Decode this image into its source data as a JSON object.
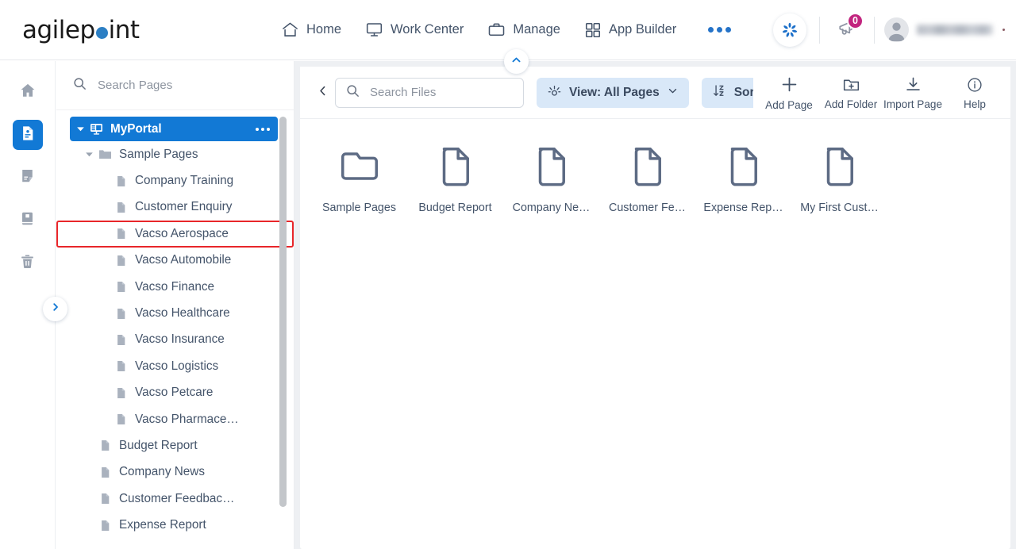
{
  "brand": {
    "name_part1": "agilep",
    "name_part2": "int",
    "dot_color": "#2c7fc4",
    "accent_blue": "#1279d5",
    "badge_color": "#c2257f",
    "highlight_red": "#e8262a"
  },
  "header": {
    "nav": [
      {
        "label": "Home",
        "icon": "home-icon"
      },
      {
        "label": "Work Center",
        "icon": "monitor-icon"
      },
      {
        "label": "Manage",
        "icon": "briefcase-icon"
      },
      {
        "label": "App Builder",
        "icon": "grid-icon"
      }
    ],
    "more_icon": "ellipsis-icon",
    "ai_icon": "agilepoint-ai-icon",
    "announcement_icon": "megaphone-icon",
    "announcement_count": "0",
    "avatar_icon": "user-avatar-icon",
    "user_name": "",
    "collapse_icon": "chevron-up-icon"
  },
  "rail": {
    "items": [
      {
        "icon": "home-icon",
        "name": "rail-item-home",
        "active": false
      },
      {
        "icon": "page-icon",
        "name": "rail-item-pages",
        "active": true
      },
      {
        "icon": "form-icon",
        "name": "rail-item-forms",
        "active": false
      },
      {
        "icon": "book-icon",
        "name": "rail-item-library",
        "active": false
      },
      {
        "icon": "trash-icon",
        "name": "rail-item-recycle-bin",
        "active": false
      }
    ],
    "expand_icon": "chevron-right-icon"
  },
  "tree": {
    "search": {
      "placeholder": "Search Pages",
      "icon": "search-icon",
      "value": ""
    },
    "nodes": [
      {
        "label": "MyPortal",
        "icon": "portal-icon",
        "indent": 0,
        "caret": "down",
        "selected": true,
        "highlighted": false,
        "dots": true
      },
      {
        "label": "Sample Pages",
        "icon": "folder-icon",
        "indent": 1,
        "caret": "down",
        "selected": false,
        "highlighted": false,
        "dots": false
      },
      {
        "label": "Company Training",
        "icon": "page-icon",
        "indent": 2,
        "caret": "none",
        "selected": false,
        "highlighted": false,
        "dots": false
      },
      {
        "label": "Customer Enquiry",
        "icon": "page-icon",
        "indent": 2,
        "caret": "none",
        "selected": false,
        "highlighted": false,
        "dots": false
      },
      {
        "label": "Vacso Aerospace",
        "icon": "page-icon",
        "indent": 2,
        "caret": "none",
        "selected": false,
        "highlighted": true,
        "dots": false
      },
      {
        "label": "Vacso Automobile",
        "icon": "page-icon",
        "indent": 2,
        "caret": "none",
        "selected": false,
        "highlighted": false,
        "dots": false
      },
      {
        "label": "Vacso Finance",
        "icon": "page-icon",
        "indent": 2,
        "caret": "none",
        "selected": false,
        "highlighted": false,
        "dots": false
      },
      {
        "label": "Vacso Healthcare",
        "icon": "page-icon",
        "indent": 2,
        "caret": "none",
        "selected": false,
        "highlighted": false,
        "dots": false
      },
      {
        "label": "Vacso Insurance",
        "icon": "page-icon",
        "indent": 2,
        "caret": "none",
        "selected": false,
        "highlighted": false,
        "dots": false
      },
      {
        "label": "Vacso Logistics",
        "icon": "page-icon",
        "indent": 2,
        "caret": "none",
        "selected": false,
        "highlighted": false,
        "dots": false
      },
      {
        "label": "Vacso Petcare",
        "icon": "page-icon",
        "indent": 2,
        "caret": "none",
        "selected": false,
        "highlighted": false,
        "dots": false
      },
      {
        "label": "Vacso Pharmace…",
        "icon": "page-icon",
        "indent": 2,
        "caret": "none",
        "selected": false,
        "highlighted": false,
        "dots": false
      },
      {
        "label": "Budget Report",
        "icon": "page-icon",
        "indent": 1,
        "caret": "none",
        "selected": false,
        "highlighted": false,
        "dots": false
      },
      {
        "label": "Company News",
        "icon": "page-icon",
        "indent": 1,
        "caret": "none",
        "selected": false,
        "highlighted": false,
        "dots": false
      },
      {
        "label": "Customer Feedbac…",
        "icon": "page-icon",
        "indent": 1,
        "caret": "none",
        "selected": false,
        "highlighted": false,
        "dots": false
      },
      {
        "label": "Expense Report",
        "icon": "page-icon",
        "indent": 1,
        "caret": "none",
        "selected": false,
        "highlighted": false,
        "dots": false
      }
    ]
  },
  "toolbar": {
    "prev_icon": "chevron-left-icon",
    "next_icon": "chevron-right-icon",
    "search": {
      "placeholder": "Search Files",
      "icon": "search-icon",
      "value": ""
    },
    "view_label": "View: All Pages",
    "view_icon": "view-options-icon",
    "view_caret": "chevron-down-icon",
    "sort_label": "Sort B",
    "sort_icon": "sort-az-icon",
    "actions": [
      {
        "label": "Add Page",
        "icon": "plus-icon"
      },
      {
        "label": "Add Folder",
        "icon": "folder-plus-icon"
      },
      {
        "label": "Import Page",
        "icon": "download-icon"
      },
      {
        "label": "Help",
        "icon": "info-icon"
      }
    ]
  },
  "files": {
    "tiles": [
      {
        "label": "Sample Pages",
        "type": "folder"
      },
      {
        "label": "Budget Report",
        "type": "page"
      },
      {
        "label": "Company Ne…",
        "type": "page"
      },
      {
        "label": "Customer Fe…",
        "type": "page"
      },
      {
        "label": "Expense Rep…",
        "type": "page"
      },
      {
        "label": "My First Cust…",
        "type": "page"
      }
    ]
  }
}
